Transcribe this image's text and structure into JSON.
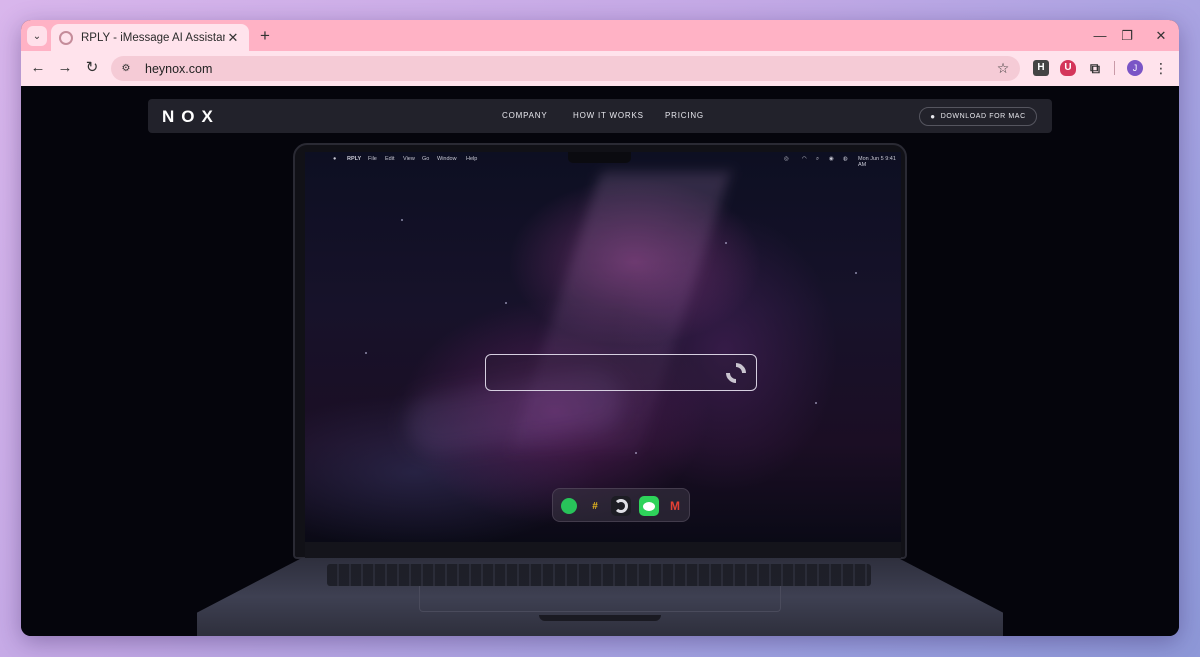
{
  "browser": {
    "tab_title": "RPLY - iMessage AI Assistant",
    "tab_close": "✕",
    "new_tab": "+",
    "url": "heynox.com",
    "tab_search_icon": "chevron-down-icon",
    "extensions": {
      "h": "H",
      "u": "U",
      "avatar": "J"
    }
  },
  "site": {
    "logo": "NOX",
    "nav": {
      "company": "COMPANY",
      "how_it_works": "HOW IT WORKS",
      "pricing": "PRICING"
    },
    "download": "DOWNLOAD FOR MAC"
  },
  "mac": {
    "menubar": {
      "app": "RPLY",
      "items": [
        "File",
        "Edit",
        "View",
        "Go",
        "Window",
        "Help"
      ],
      "clock": "Mon Jun 5  9:41 AM"
    },
    "dock": [
      "WhatsApp",
      "Slack",
      "Nox",
      "Messages",
      "Gmail"
    ]
  }
}
